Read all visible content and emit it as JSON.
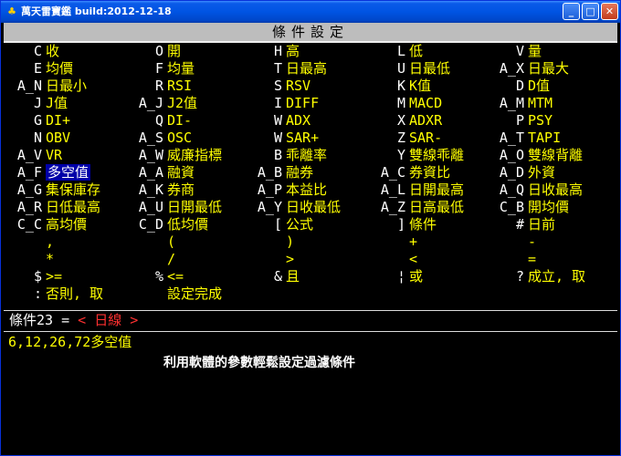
{
  "window": {
    "title": "萬天雷寶鑑 build:2012-12-18",
    "controls": {
      "minimize": "_",
      "maximize": "□",
      "close": "✕"
    }
  },
  "dialog": {
    "title": "條件設定"
  },
  "columns": [
    [
      {
        "key": "C",
        "label": "收"
      },
      {
        "key": "E",
        "label": "均價"
      },
      {
        "key": "A_N",
        "label": "日最小"
      },
      {
        "key": "J",
        "label": "J值"
      },
      {
        "key": "G",
        "label": "DI+"
      },
      {
        "key": "N",
        "label": "OBV"
      },
      {
        "key": "A_V",
        "label": "VR"
      },
      {
        "key": "A_F",
        "label": "多空值",
        "selected": true
      },
      {
        "key": "A_G",
        "label": "集保庫存"
      },
      {
        "key": "A_R",
        "label": "日低最高"
      },
      {
        "key": "C_C",
        "label": "高均價"
      },
      {
        "key": "",
        "label": ","
      },
      {
        "key": "",
        "label": "*"
      },
      {
        "key": "$",
        "label": ">="
      },
      {
        "key": ":",
        "label": "否則, 取"
      }
    ],
    [
      {
        "key": "O",
        "label": "開"
      },
      {
        "key": "F",
        "label": "均量"
      },
      {
        "key": "R",
        "label": "RSI"
      },
      {
        "key": "A_J",
        "label": "J2值"
      },
      {
        "key": "Q",
        "label": "DI-"
      },
      {
        "key": "A_S",
        "label": "OSC"
      },
      {
        "key": "A_W",
        "label": "威廉指標"
      },
      {
        "key": "A_A",
        "label": "融資"
      },
      {
        "key": "A_K",
        "label": "券商"
      },
      {
        "key": "A_U",
        "label": "日開最低"
      },
      {
        "key": "C_D",
        "label": "低均價"
      },
      {
        "key": "",
        "label": "("
      },
      {
        "key": "",
        "label": "/"
      },
      {
        "key": "%",
        "label": "<="
      },
      {
        "key": "",
        "label": "設定完成"
      }
    ],
    [
      {
        "key": "H",
        "label": "高"
      },
      {
        "key": "T",
        "label": "日最高"
      },
      {
        "key": "S",
        "label": "RSV"
      },
      {
        "key": "I",
        "label": "DIFF"
      },
      {
        "key": "W",
        "label": "ADX"
      },
      {
        "key": "W",
        "label": "SAR+"
      },
      {
        "key": "B",
        "label": "乖離率"
      },
      {
        "key": "A_B",
        "label": "融券"
      },
      {
        "key": "A_P",
        "label": "本益比"
      },
      {
        "key": "A_Y",
        "label": "日收最低"
      },
      {
        "key": "[",
        "label": "公式"
      },
      {
        "key": "",
        "label": ")"
      },
      {
        "key": "",
        "label": ">"
      },
      {
        "key": "&",
        "label": "且"
      }
    ],
    [
      {
        "key": "L",
        "label": "低"
      },
      {
        "key": "U",
        "label": "日最低"
      },
      {
        "key": "K",
        "label": "K值"
      },
      {
        "key": "M",
        "label": "MACD"
      },
      {
        "key": "X",
        "label": "ADXR"
      },
      {
        "key": "Z",
        "label": "SAR-"
      },
      {
        "key": "Y",
        "label": "雙線乖離"
      },
      {
        "key": "A_C",
        "label": "券資比"
      },
      {
        "key": "A_L",
        "label": "日開最高"
      },
      {
        "key": "A_Z",
        "label": "日高最低"
      },
      {
        "key": "]",
        "label": "條件"
      },
      {
        "key": "",
        "label": "+"
      },
      {
        "key": "",
        "label": "<"
      },
      {
        "key": "¦",
        "label": "或"
      }
    ],
    [
      {
        "key": "V",
        "label": "量"
      },
      {
        "key": "A_X",
        "label": "日最大"
      },
      {
        "key": "D",
        "label": "D值"
      },
      {
        "key": "A_M",
        "label": "MTM"
      },
      {
        "key": "P",
        "label": "PSY"
      },
      {
        "key": "A_T",
        "label": "TAPI"
      },
      {
        "key": "A_O",
        "label": "雙線背離"
      },
      {
        "key": "A_D",
        "label": "外資"
      },
      {
        "key": "A_Q",
        "label": "日收最高"
      },
      {
        "key": "C_B",
        "label": "開均價"
      },
      {
        "key": "#",
        "label": "日前"
      },
      {
        "key": "",
        "label": "-"
      },
      {
        "key": "",
        "label": "="
      },
      {
        "key": "?",
        "label": "成立, 取"
      }
    ]
  ],
  "condition": {
    "label": "條件23 = ",
    "value": "< 日線 >"
  },
  "formula": "6,12,26,72多空值",
  "description": "利用軟體的參數輕鬆設定過濾條件"
}
